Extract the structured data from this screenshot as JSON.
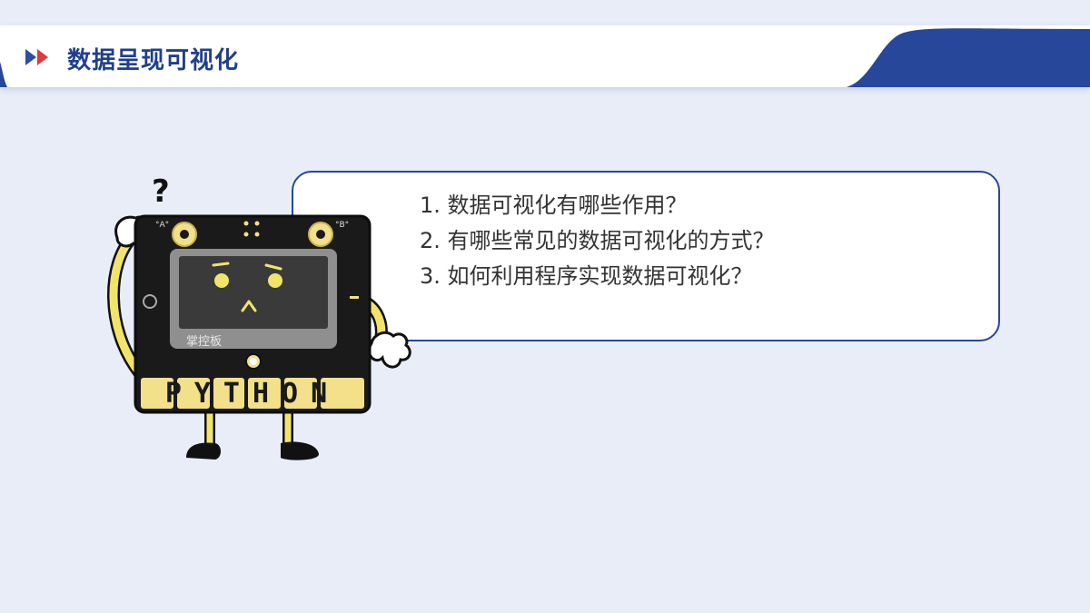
{
  "header": {
    "title": "数据呈现可视化",
    "accent_color": "#1f3f8e",
    "arrow_colors": [
      "#2b4fa5",
      "#e0393e"
    ]
  },
  "bubble": {
    "questions": [
      "1. 数据可视化有哪些作用？",
      "2. 有哪些常见的数据可视化的方式？",
      "3. 如何利用程序实现数据可视化？"
    ]
  },
  "mascot": {
    "question_mark": "?",
    "button_a": "°A°",
    "button_b": "°B°",
    "screen_label": "掌控板",
    "board_text": "PYTHON"
  }
}
